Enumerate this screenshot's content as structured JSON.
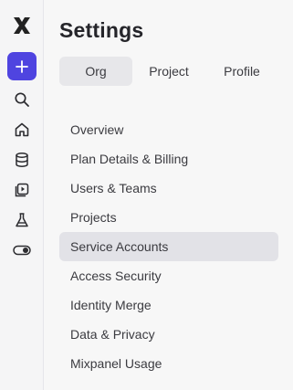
{
  "theme": {
    "accent": "#4f44e0"
  },
  "rail": {
    "icons": [
      "logo-icon",
      "plus-icon",
      "search-icon",
      "home-icon",
      "database-icon",
      "play-icon",
      "flask-icon",
      "toggle-icon"
    ]
  },
  "settings": {
    "title": "Settings",
    "tabs": [
      {
        "label": "Org",
        "active": true
      },
      {
        "label": "Project",
        "active": false
      },
      {
        "label": "Profile",
        "active": false
      }
    ],
    "menu": [
      {
        "label": "Overview",
        "active": false
      },
      {
        "label": "Plan Details & Billing",
        "active": false
      },
      {
        "label": "Users & Teams",
        "active": false
      },
      {
        "label": "Projects",
        "active": false
      },
      {
        "label": "Service Accounts",
        "active": true
      },
      {
        "label": "Access Security",
        "active": false
      },
      {
        "label": "Identity Merge",
        "active": false
      },
      {
        "label": "Data & Privacy",
        "active": false
      },
      {
        "label": "Mixpanel Usage",
        "active": false
      }
    ]
  }
}
